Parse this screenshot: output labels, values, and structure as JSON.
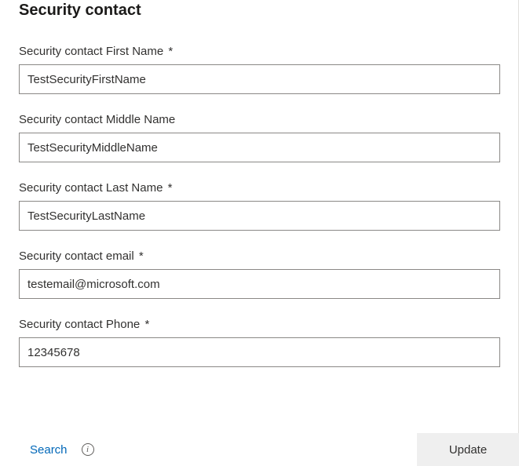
{
  "heading": "Security contact",
  "required_marker": "*",
  "fields": {
    "first_name": {
      "label": "Security contact First Name",
      "required": true,
      "value": "TestSecurityFirstName"
    },
    "middle_name": {
      "label": "Security contact Middle Name",
      "required": false,
      "value": "TestSecurityMiddleName"
    },
    "last_name": {
      "label": "Security contact Last Name",
      "required": true,
      "value": "TestSecurityLastName"
    },
    "email": {
      "label": "Security contact email",
      "required": true,
      "value": "testemail@microsoft.com"
    },
    "phone": {
      "label": "Security contact Phone",
      "required": true,
      "value": "12345678"
    }
  },
  "actions": {
    "search_label": "Search",
    "info_glyph": "i",
    "update_label": "Update"
  }
}
